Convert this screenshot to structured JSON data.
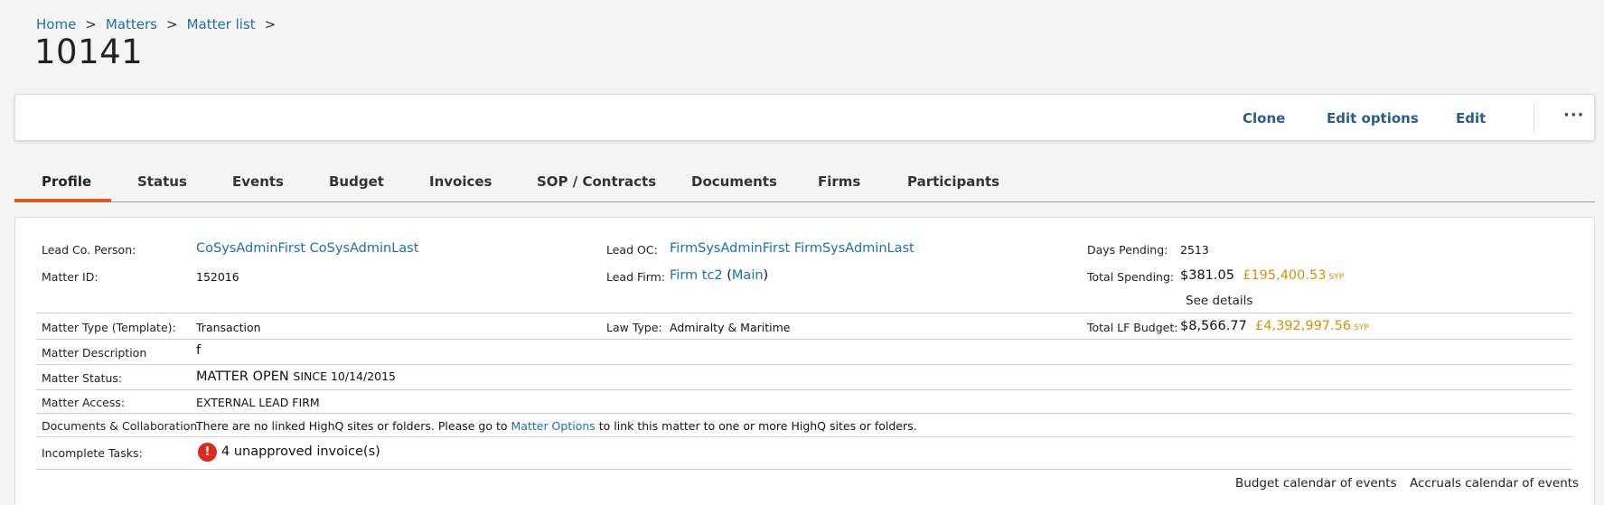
{
  "breadcrumb": {
    "home": "Home",
    "matters": "Matters",
    "matter_list": "Matter list",
    "sep": ">"
  },
  "page_title": "10141",
  "actions": {
    "clone": "Clone",
    "edit_options": "Edit options",
    "edit": "Edit",
    "more": "···"
  },
  "tabs": [
    "Profile",
    "Status",
    "Events",
    "Budget",
    "Invoices",
    "SOP / Contracts",
    "Documents",
    "Firms",
    "Participants"
  ],
  "profile": {
    "lead_co_person": {
      "label": "Lead Co. Person:",
      "value": "CoSysAdminFirst CoSysAdminLast"
    },
    "lead_oc": {
      "label": "Lead OC:",
      "value": "FirmSysAdminFirst FirmSysAdminLast"
    },
    "days_pending": {
      "label": "Days Pending:",
      "value": "2513"
    },
    "matter_id": {
      "label": "Matter ID:",
      "value": "152016"
    },
    "lead_firm": {
      "label": "Lead Firm:",
      "firm": "Firm tc2",
      "open_paren": "(",
      "office": "Main",
      "close_paren": ")"
    },
    "total_spending": {
      "label": "Total Spending:",
      "usd": "$381.05",
      "gbp": "£195,400.53",
      "currency": "SYP",
      "see_details": "See details"
    },
    "matter_type": {
      "label": "Matter Type (Template):",
      "value": "Transaction"
    },
    "law_type": {
      "label": "Law Type:",
      "value": "Admiralty & Maritime"
    },
    "total_lf_budget": {
      "label": "Total LF Budget:",
      "usd": "$8,566.77",
      "gbp": "£4,392,997.56",
      "currency": "SYP"
    },
    "matter_description": {
      "label": "Matter Description",
      "value": "f"
    },
    "matter_status": {
      "label": "Matter Status:",
      "value": "MATTER OPEN",
      "since": "SINCE 10/14/2015"
    },
    "matter_access": {
      "label": "Matter Access:",
      "value": "EXTERNAL LEAD FIRM"
    },
    "docs_collab": {
      "label": "Documents & Collaboration:",
      "text_before": "There are no linked HighQ sites or folders. Please go to ",
      "link": "Matter Options",
      "text_after": " to link this matter to one or more HighQ sites or folders."
    },
    "incomplete_tasks": {
      "label": "Incomplete Tasks:",
      "icon": "!",
      "value": "4 unapproved invoice(s)"
    }
  },
  "footer_links": {
    "budget_calendar": "Budget calendar of events",
    "accruals_calendar": "Accruals calendar of events"
  }
}
